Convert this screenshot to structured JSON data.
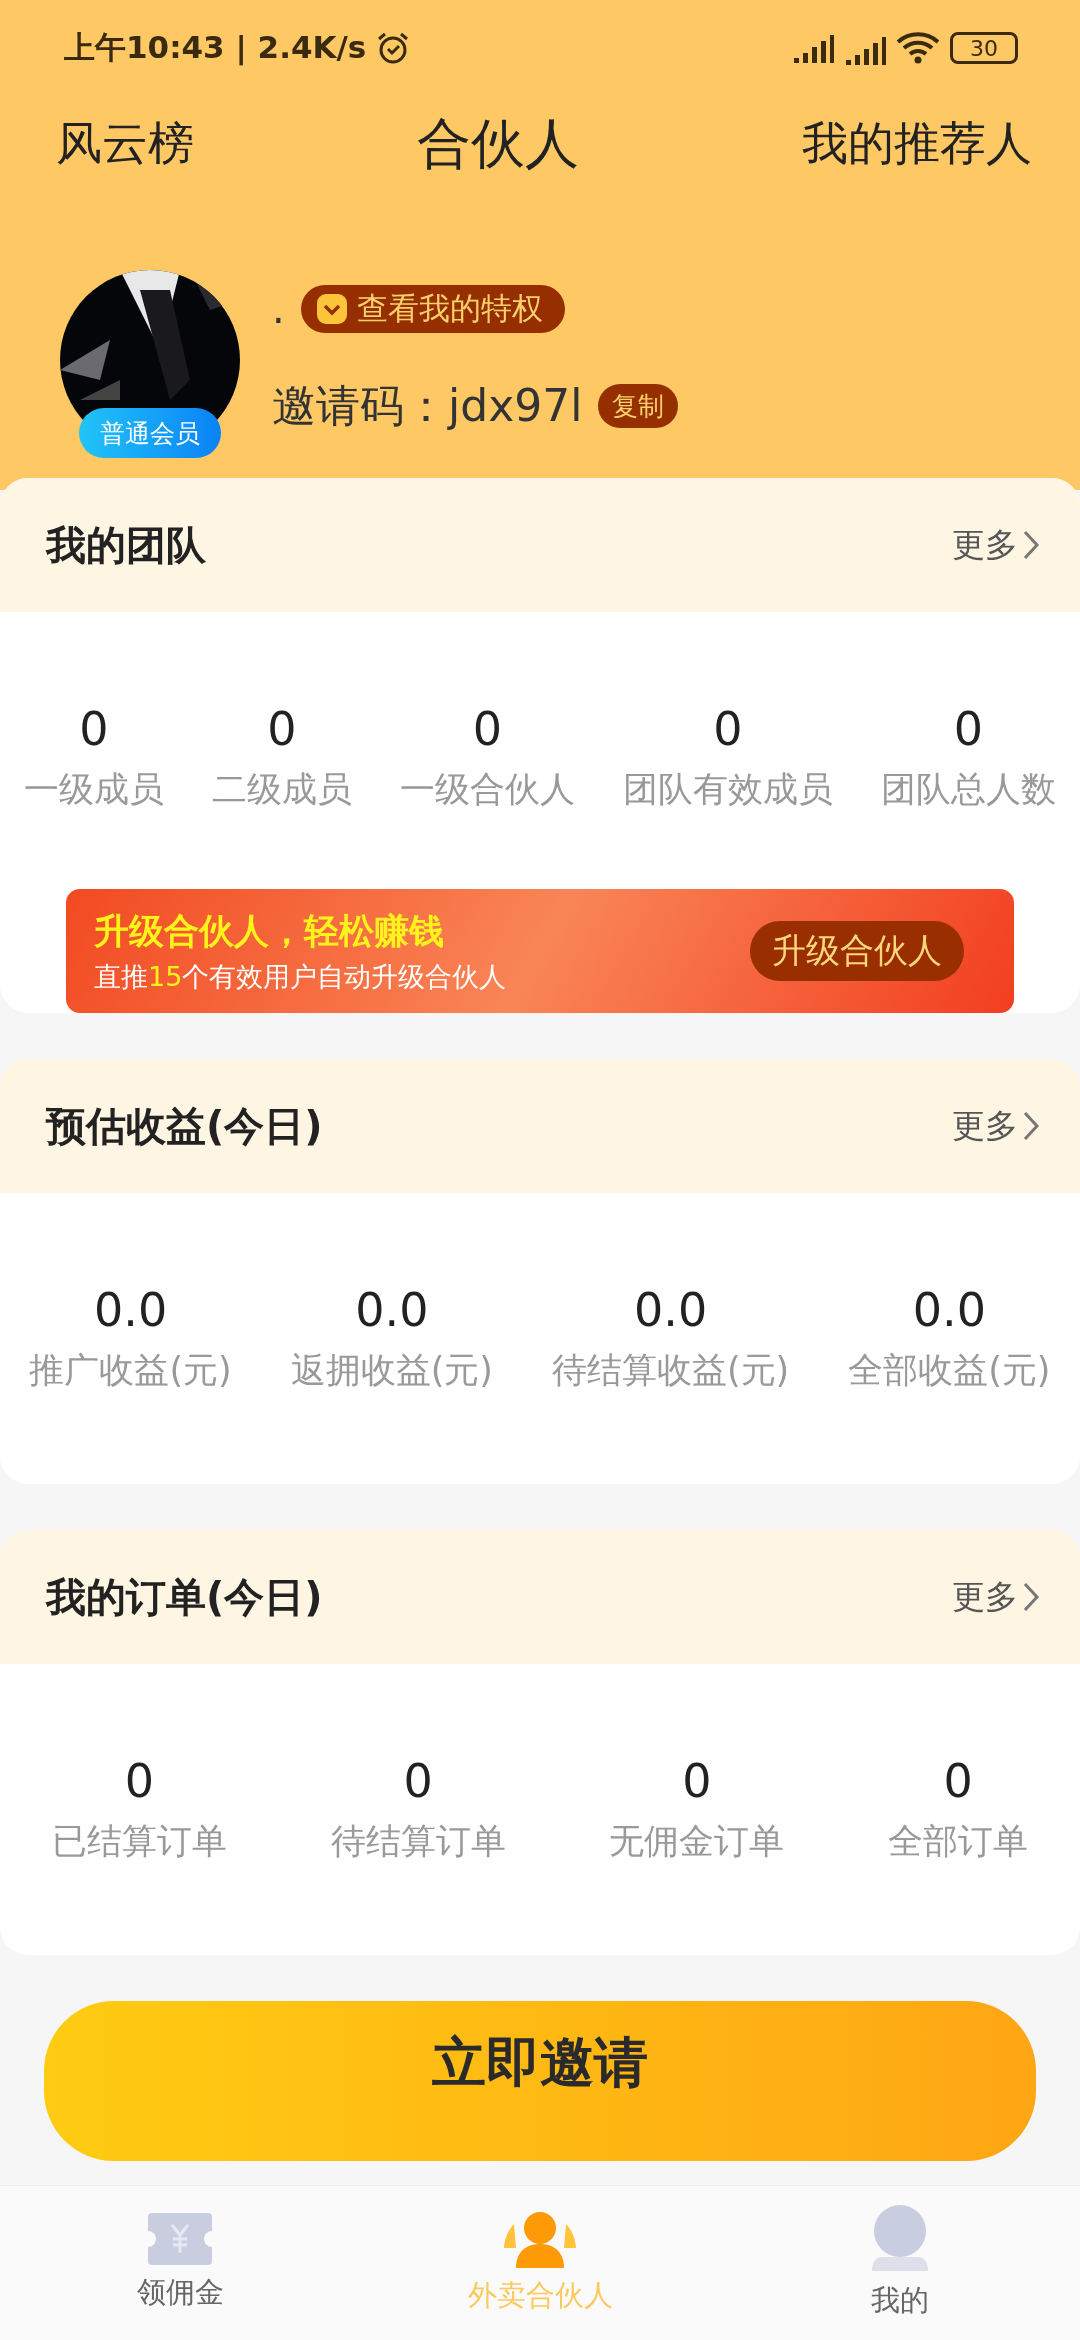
{
  "status_bar": {
    "time": "上午10:43 | 2.4K/s",
    "battery": "30"
  },
  "header": {
    "left": "风云榜",
    "title": "合伙人",
    "right": "我的推荐人"
  },
  "profile": {
    "name": ".",
    "privilege_button": "查看我的特权",
    "member_badge": "普通会员",
    "invite_label": "邀请码：",
    "invite_code": "jdx97l",
    "copy_button": "复制"
  },
  "sections": [
    {
      "title": "我的团队",
      "more": "更多",
      "stats": [
        {
          "value": "0",
          "label": "一级成员"
        },
        {
          "value": "0",
          "label": "二级成员"
        },
        {
          "value": "0",
          "label": "一级合伙人"
        },
        {
          "value": "0",
          "label": "团队有效成员"
        },
        {
          "value": "0",
          "label": "团队总人数"
        }
      ],
      "banner": {
        "title": "升级合伙人，轻松赚钱",
        "subtitle": "直推**15**个有效用户自动升级合伙人",
        "button": "升级合伙人"
      }
    },
    {
      "title": "预估收益(今日)",
      "more": "更多",
      "stats": [
        {
          "value": "0.0",
          "label": "推广收益(元)"
        },
        {
          "value": "0.0",
          "label": "返拥收益(元)"
        },
        {
          "value": "0.0",
          "label": "待结算收益(元)"
        },
        {
          "value": "0.0",
          "label": "全部收益(元)"
        }
      ]
    },
    {
      "title": "我的订单(今日)",
      "more": "更多",
      "stats": [
        {
          "value": "0",
          "label": "已结算订单"
        },
        {
          "value": "0",
          "label": "待结算订单"
        },
        {
          "value": "0",
          "label": "无佣金订单"
        },
        {
          "value": "0",
          "label": "全部订单"
        }
      ]
    }
  ],
  "invite_button": "立即邀请",
  "tab_bar": [
    {
      "kind": "ticket",
      "label": "领佣金",
      "selected": false
    },
    {
      "kind": "team",
      "label": "外卖合伙人",
      "selected": true
    },
    {
      "kind": "person",
      "label": "我的",
      "selected": false
    }
  ]
}
